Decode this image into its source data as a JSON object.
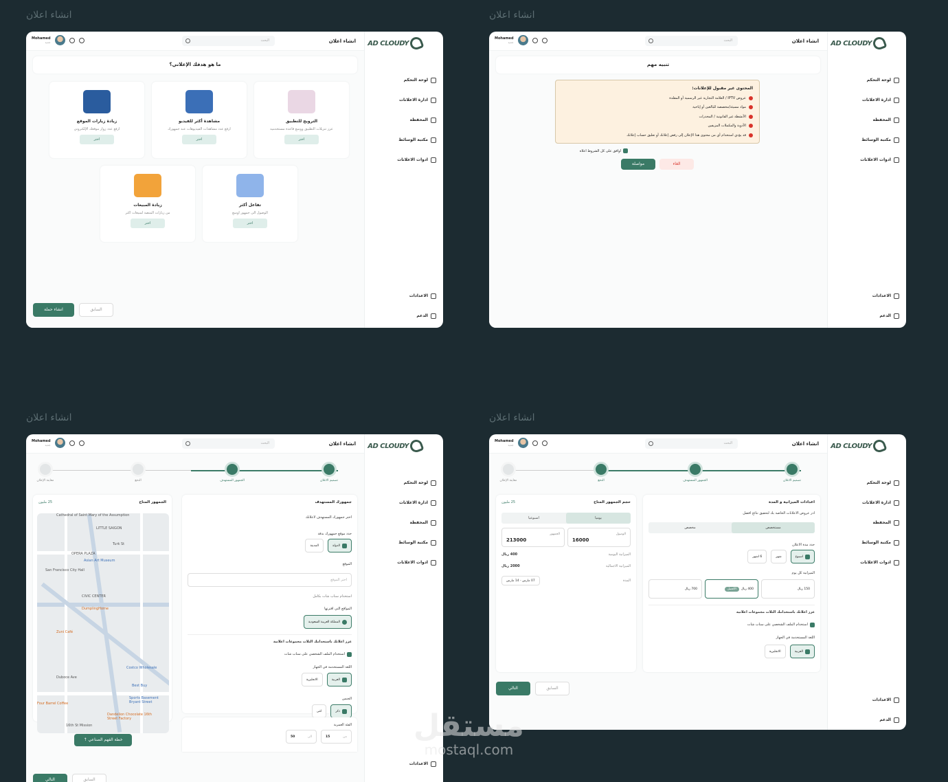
{
  "page_label": "انشاء اعلان",
  "app": {
    "logo": "AD CLOUDY",
    "title": "انشاء اعلان",
    "search_placeholder": "البحث",
    "user_name": "Mohamed",
    "user_sub": "جديد"
  },
  "nav": [
    "لوحة التحكم",
    "ادارة الاعلانات",
    "المحفظة",
    "مكتبة الوسائط",
    "ادوات الاعلانات"
  ],
  "nav_bottom": [
    "الاعدادات",
    "الدعم"
  ],
  "screen1": {
    "question": "ما هو هدفك الإعلاني؟",
    "cards": [
      {
        "title": "الترويج للتطبيق",
        "desc": "عزز تنزيلات التطبيق ووسع قاعدة مستخدميه",
        "button": "اختر",
        "color": "#ead7e4"
      },
      {
        "title": "مشاهدة أكثر للفيديو",
        "desc": "ارفع عدد مشاهدات الفيديوهات عند جمهورك",
        "button": "اختر",
        "color": "#3b6fb7"
      },
      {
        "title": "زيادة زيارات الموقع",
        "desc": "ارفع عدد زوار موقعك الإلكتروني",
        "button": "اختر",
        "color": "#2a5c9e"
      },
      {
        "title": "تفاعل أكثر",
        "desc": "الوصول الى جمهور اوسع",
        "button": "اختر",
        "color": "#8fb4ea"
      },
      {
        "title": "زيادة المبيعات",
        "desc": "من زيارات المنصة لمبيعات اكثر",
        "button": "اختر",
        "color": "#f2a33a"
      }
    ],
    "next": "انشاء حملة",
    "prev": "السابق"
  },
  "screen2": {
    "heading": "تنبيه مهم",
    "warn_title": "المحتوى غير مقبول للإعلانات:",
    "items": [
      "عروض IPTV / العلامة التجارية غير الرسمية أو المقلدة",
      "مواد مسيئة/مخصصة للبالغين أو إباحية",
      "الأنشطة غير القانونية / المخدرات",
      "الأدوية والمكملات المزيفين",
      "قد يؤدي استخدام أي من محتوى هذا الإعلان إلى رفض إعلانك أو تعليق حساب إعلانك"
    ],
    "agree": "اوافق على كل الشروط اعلاه",
    "continue": "مواصلة",
    "cancel": "الغاء"
  },
  "steps": [
    "تصميم الاعلان",
    "الجمهور المستهدف",
    "الدفع",
    "معاينة الإعلان"
  ],
  "screen3": {
    "audience_title": "جمهورك المستهدف",
    "audience_sub": "اختر جمهورك المستهدف لاعلانك",
    "location_label": "حدد موقع جمهورك بدقة",
    "opt_country": "الدولة",
    "opt_city": "المدينة",
    "site_label": "الموقع",
    "site_placeholder": "اختر الموقع",
    "snap_note": "استخدام سناب شات بكامل",
    "suggested_label": "المواقع التي اقترتها",
    "suggested_value": "المملكة العربية السعودية",
    "snap_title": "عزز اعلانك باستخدامك الثلاث مجموعات اعلانية",
    "snap_check": "استخدام الملف الشخصي على سناب شات",
    "lang_label": "اللغة المستخدمة في الجهاز",
    "lang_ar": "العربية",
    "lang_en": "الانجليزية",
    "gender_label": "الجنس",
    "male": "ذكر",
    "female": "انثى",
    "age_label": "الفئة العمرية",
    "age_from_l": "من",
    "age_from": "15",
    "age_to_l": "الى",
    "age_to": "50",
    "reach_label": "الجمهور المتاح",
    "reach_value": "25 مليون",
    "map_labels": [
      "Cathedral of Saint Mary of the Assumption",
      "LITTLE SAIGON",
      "Turk St",
      "OPERA PLAZA",
      "Asian Art Museum",
      "San Francisco City Hall",
      "CIVIC CENTER",
      "DumplingHome",
      "Zuni Café",
      "Costco Wholesale",
      "Duboce Ave",
      "Best Buy",
      "Sports Basement Bryant Street",
      "Dandelion Chocolate 16th Street Factory",
      "Four Barrel Coffee",
      "16th St Mission"
    ],
    "ai_button": "خطة الفهم الصناعي",
    "next": "التالي",
    "prev": "السابق"
  },
  "screen4": {
    "title": "اعدادات الميزانية و المدة",
    "sub": "ادر عروض الاعلانات الخاصة بك لتحقيق نتائج افضل",
    "tab_a": "مستخصص",
    "tab_b": "مخصص",
    "duration_label": "حدد مدة الاعلان",
    "durations": [
      "اسبوع",
      "شهر",
      "6 اشهر"
    ],
    "daily_label": "الميزانية كل يوم",
    "budgets": [
      "150 ريال",
      "400 ريال",
      "700 ريال"
    ],
    "recommended": "الأفضل",
    "snap_title": "عزز اعلانك باستخدامك الثلاث مجموعات اعلانية",
    "snap_check": "استخدام الملف الشخصي على سناب شات",
    "lang_label": "اللغة المستخدمة في الجهاز",
    "lang_ar": "العربية",
    "lang_en": "الانجليزية",
    "reach_label": "حجم الجمهور المتاح",
    "reach_value": "25 مليون",
    "seg_daily": "يوميا",
    "seg_weekly": "اسبوعيا",
    "reach_l": "الوصول",
    "reach_v": "16000",
    "aud_l": "الجمهور",
    "aud_v": "213000",
    "daily_budget_l": "الميزانية اليومية",
    "daily_budget_v": "400 ريال",
    "total_budget_l": "الميزانية الاجمالية",
    "total_budget_v": "2000 ريال",
    "duration_l": "المدة",
    "duration_v": "07 مارس - 14 مارس",
    "next": "التالي",
    "prev": "السابق"
  },
  "watermark": {
    "ar": "مستقل",
    "en": "mostaql.com"
  }
}
